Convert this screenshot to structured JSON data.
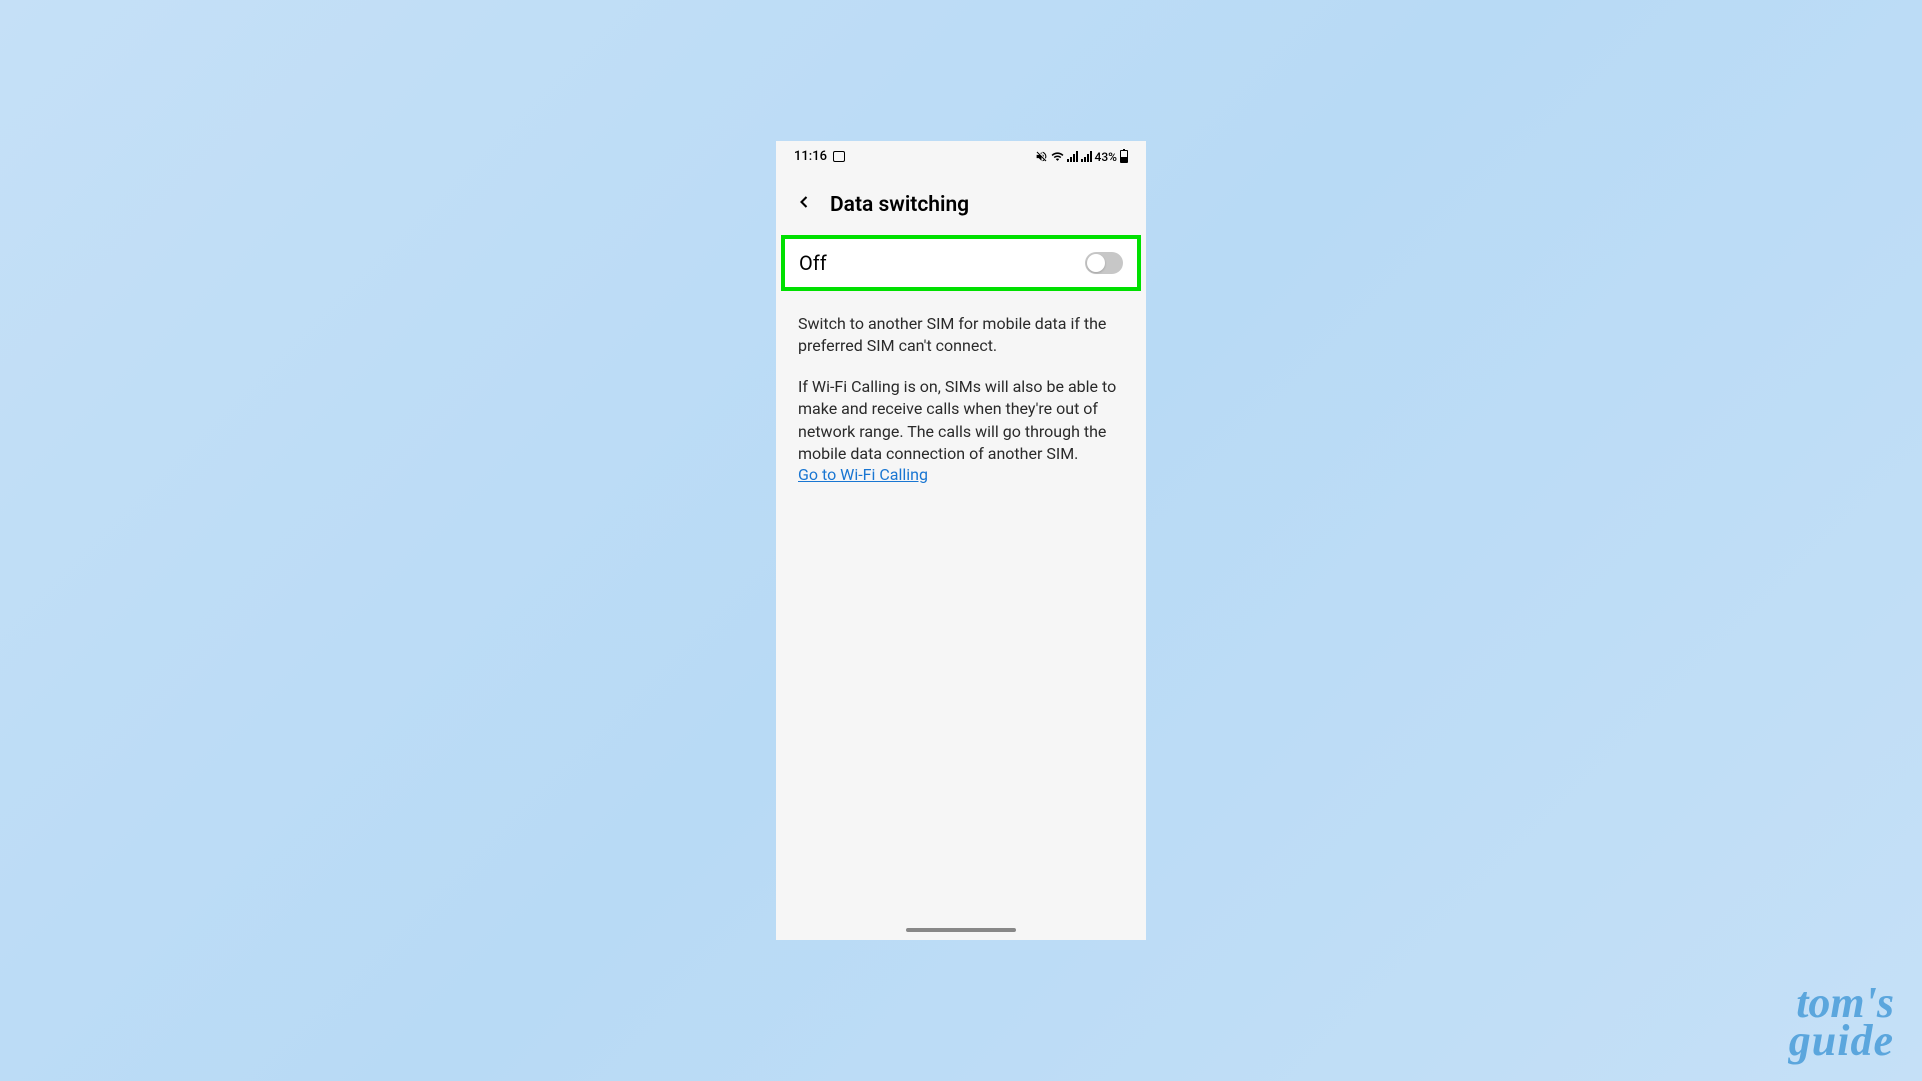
{
  "statusBar": {
    "time": "11:16",
    "batteryPercent": "43%"
  },
  "header": {
    "title": "Data switching"
  },
  "toggle": {
    "label": "Off",
    "state": "off"
  },
  "content": {
    "description1": "Switch to another SIM for mobile data if the preferred SIM can't connect.",
    "description2": "If Wi-Fi Calling is on, SIMs will also be able to make and receive calls when they're out of network range. The calls will go through the mobile data connection of another SIM.",
    "linkText": "Go to Wi-Fi Calling"
  },
  "watermark": {
    "line1": "tom's",
    "line2": "guide"
  }
}
